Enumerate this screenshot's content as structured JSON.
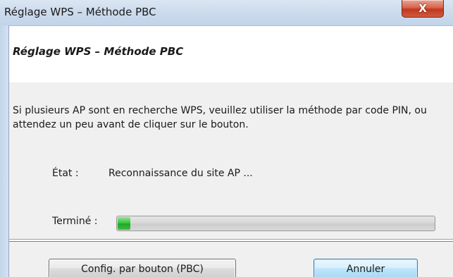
{
  "window": {
    "title": "Réglage WPS – Méthode PBC",
    "close_label": "X"
  },
  "dialog": {
    "heading": "Réglage WPS – Méthode PBC",
    "instructions": "Si plusieurs AP sont en recherche WPS, veuillez utiliser la méthode par code PIN, ou attendez un peu avant de cliquer sur le bouton.",
    "status_label": "État :",
    "status_value": "Reconnaissance du site AP ...",
    "progress_label": "Terminé :",
    "progress_fraction": 0.04
  },
  "buttons": {
    "pbc_label": "Config. par bouton (PBC)",
    "cancel_label": "Annuler"
  },
  "colors": {
    "progress_fill": "#3cc442",
    "close_button": "#c1381f",
    "titlebar": "#cddbec"
  },
  "icons": {
    "close": "close-icon"
  }
}
